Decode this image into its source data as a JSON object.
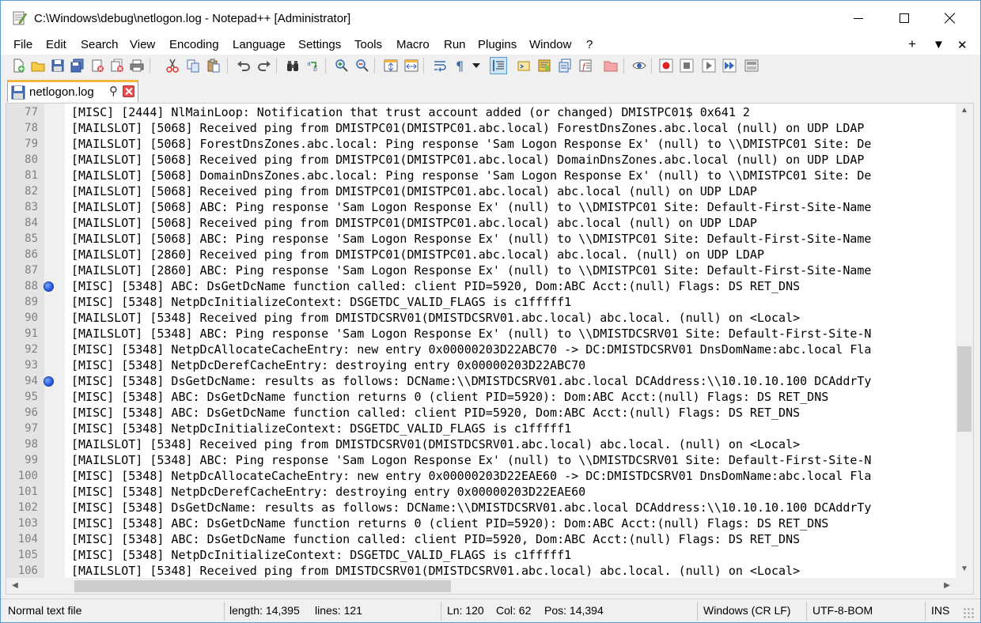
{
  "window": {
    "title": "C:\\Windows\\debug\\netlogon.log - Notepad++ [Administrator]"
  },
  "menu": {
    "items": [
      "File",
      "Edit",
      "Search",
      "View",
      "Encoding",
      "Language",
      "Settings",
      "Tools",
      "Macro",
      "Run",
      "Plugins",
      "Window",
      "?"
    ],
    "right": [
      "+",
      "▼",
      "✕"
    ]
  },
  "toolbar": {
    "icons": [
      "new-file-icon",
      "open-file-icon",
      "save-icon",
      "save-all-icon",
      "close-icon",
      "close-all-icon",
      "print-icon",
      "cut-icon",
      "copy-icon",
      "paste-icon",
      "undo-icon",
      "redo-icon",
      "find-icon",
      "replace-icon",
      "zoom-in-icon",
      "zoom-out-icon",
      "sync-vertical-icon",
      "sync-horizontal-icon",
      "word-wrap-icon",
      "show-all-characters-icon",
      "dropdown-arrow-icon",
      "indent-guide-icon",
      "language-icon",
      "doc-map-icon",
      "document-list-icon",
      "function-list-icon",
      "folder-workspace-icon",
      "monitoring-icon",
      "record-macro-icon",
      "stop-macro-icon",
      "play-macro-icon",
      "run-macro-multiple-icon",
      "save-macro-icon"
    ]
  },
  "tab": {
    "label": "netlogon.log",
    "pin_glyph": "⚲"
  },
  "editor": {
    "lines": [
      {
        "n": "77",
        "bookmark": false,
        "text": "[MISC] [2444] NlMainLoop: Notification that trust account added (or changed) DMISTPC01$ 0x641 2"
      },
      {
        "n": "78",
        "bookmark": false,
        "text": "[MAILSLOT] [5068] Received ping from DMISTPC01(DMISTPC01.abc.local) ForestDnsZones.abc.local (null) on UDP LDAP"
      },
      {
        "n": "79",
        "bookmark": false,
        "text": "[MAILSLOT] [5068] ForestDnsZones.abc.local: Ping response 'Sam Logon Response Ex' (null) to \\\\DMISTPC01 Site: De"
      },
      {
        "n": "80",
        "bookmark": false,
        "text": "[MAILSLOT] [5068] Received ping from DMISTPC01(DMISTPC01.abc.local) DomainDnsZones.abc.local (null) on UDP LDAP"
      },
      {
        "n": "81",
        "bookmark": false,
        "text": "[MAILSLOT] [5068] DomainDnsZones.abc.local: Ping response 'Sam Logon Response Ex' (null) to \\\\DMISTPC01 Site: De"
      },
      {
        "n": "82",
        "bookmark": false,
        "text": "[MAILSLOT] [5068] Received ping from DMISTPC01(DMISTPC01.abc.local) abc.local (null) on UDP LDAP"
      },
      {
        "n": "83",
        "bookmark": false,
        "text": "[MAILSLOT] [5068] ABC: Ping response 'Sam Logon Response Ex' (null) to \\\\DMISTPC01 Site: Default-First-Site-Name"
      },
      {
        "n": "84",
        "bookmark": false,
        "text": "[MAILSLOT] [5068] Received ping from DMISTPC01(DMISTPC01.abc.local) abc.local (null) on UDP LDAP"
      },
      {
        "n": "85",
        "bookmark": false,
        "text": "[MAILSLOT] [5068] ABC: Ping response 'Sam Logon Response Ex' (null) to \\\\DMISTPC01 Site: Default-First-Site-Name"
      },
      {
        "n": "86",
        "bookmark": false,
        "text": "[MAILSLOT] [2860] Received ping from DMISTPC01(DMISTPC01.abc.local) abc.local. (null) on UDP LDAP"
      },
      {
        "n": "87",
        "bookmark": false,
        "text": "[MAILSLOT] [2860] ABC: Ping response 'Sam Logon Response Ex' (null) to \\\\DMISTPC01 Site: Default-First-Site-Name"
      },
      {
        "n": "88",
        "bookmark": true,
        "text": "[MISC] [5348] ABC: DsGetDcName function called: client PID=5920, Dom:ABC Acct:(null) Flags: DS RET_DNS"
      },
      {
        "n": "89",
        "bookmark": false,
        "text": "[MISC] [5348] NetpDcInitializeContext: DSGETDC_VALID_FLAGS is c1fffff1"
      },
      {
        "n": "90",
        "bookmark": false,
        "text": "[MAILSLOT] [5348] Received ping from DMISTDCSRV01(DMISTDCSRV01.abc.local) abc.local. (null) on <Local>"
      },
      {
        "n": "91",
        "bookmark": false,
        "text": "[MAILSLOT] [5348] ABC: Ping response 'Sam Logon Response Ex' (null) to \\\\DMISTDCSRV01 Site: Default-First-Site-N"
      },
      {
        "n": "92",
        "bookmark": false,
        "text": "[MISC] [5348] NetpDcAllocateCacheEntry: new entry 0x00000203D22ABC70 -> DC:DMISTDCSRV01 DnsDomName:abc.local Fla"
      },
      {
        "n": "93",
        "bookmark": false,
        "text": "[MISC] [5348] NetpDcDerefCacheEntry: destroying entry 0x00000203D22ABC70"
      },
      {
        "n": "94",
        "bookmark": true,
        "text": "[MISC] [5348] DsGetDcName: results as follows: DCName:\\\\DMISTDCSRV01.abc.local DCAddress:\\\\10.10.10.100 DCAddrTy"
      },
      {
        "n": "95",
        "bookmark": false,
        "text": "[MISC] [5348] ABC: DsGetDcName function returns 0 (client PID=5920): Dom:ABC Acct:(null) Flags: DS RET_DNS"
      },
      {
        "n": "96",
        "bookmark": false,
        "text": "[MISC] [5348] ABC: DsGetDcName function called: client PID=5920, Dom:ABC Acct:(null) Flags: DS RET_DNS"
      },
      {
        "n": "97",
        "bookmark": false,
        "text": "[MISC] [5348] NetpDcInitializeContext: DSGETDC_VALID_FLAGS is c1fffff1"
      },
      {
        "n": "98",
        "bookmark": false,
        "text": "[MAILSLOT] [5348] Received ping from DMISTDCSRV01(DMISTDCSRV01.abc.local) abc.local. (null) on <Local>"
      },
      {
        "n": "99",
        "bookmark": false,
        "text": "[MAILSLOT] [5348] ABC: Ping response 'Sam Logon Response Ex' (null) to \\\\DMISTDCSRV01 Site: Default-First-Site-N"
      },
      {
        "n": "100",
        "bookmark": false,
        "text": "[MISC] [5348] NetpDcAllocateCacheEntry: new entry 0x00000203D22EAE60 -> DC:DMISTDCSRV01 DnsDomName:abc.local Fla"
      },
      {
        "n": "101",
        "bookmark": false,
        "text": "[MISC] [5348] NetpDcDerefCacheEntry: destroying entry 0x00000203D22EAE60"
      },
      {
        "n": "102",
        "bookmark": false,
        "text": "[MISC] [5348] DsGetDcName: results as follows: DCName:\\\\DMISTDCSRV01.abc.local DCAddress:\\\\10.10.10.100 DCAddrTy"
      },
      {
        "n": "103",
        "bookmark": false,
        "text": "[MISC] [5348] ABC: DsGetDcName function returns 0 (client PID=5920): Dom:ABC Acct:(null) Flags: DS RET_DNS"
      },
      {
        "n": "104",
        "bookmark": false,
        "text": "[MISC] [5348] ABC: DsGetDcName function called: client PID=5920, Dom:ABC Acct:(null) Flags: DS RET_DNS"
      },
      {
        "n": "105",
        "bookmark": false,
        "text": "[MISC] [5348] NetpDcInitializeContext: DSGETDC_VALID_FLAGS is c1fffff1"
      },
      {
        "n": "106",
        "bookmark": false,
        "text": "[MAILSLOT] [5348] Received ping from DMISTDCSRV01(DMISTDCSRV01.abc.local) abc.local. (null) on <Local>"
      }
    ]
  },
  "statusbar": {
    "file_type": "Normal text file",
    "length": "length: 14,395",
    "lines": "lines: 121",
    "ln": "Ln: 120",
    "col": "Col: 62",
    "pos": "Pos: 14,394",
    "eol": "Windows (CR LF)",
    "encoding": "UTF-8-BOM",
    "mode": "INS"
  },
  "colors": {
    "bookmark": "#1f4fd6",
    "tab_accent": "#f5b640",
    "window_border": "#5b9bd5"
  }
}
